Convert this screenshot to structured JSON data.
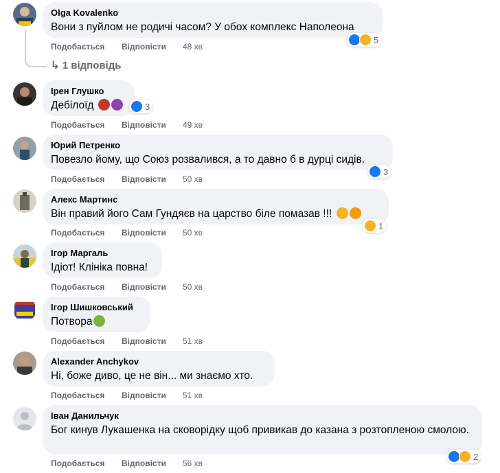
{
  "actions": {
    "like": "Подобається",
    "reply": "Відповісти"
  },
  "comments": [
    {
      "author": "Olga Kovalenko",
      "text": "Вони з пуйлом не родичі часом? У обох комплекс Наполеона",
      "time": "48 хв",
      "reactions": "5",
      "replies": "1 відповідь"
    },
    {
      "author": "Ірен Глушко",
      "text": "Дебілоїд",
      "time": "49 хв",
      "reactions": "3"
    },
    {
      "author": "Юрий Петренко",
      "text": "Повезло йому, що Союз розвалився, а то давно б в дурці сидів.",
      "time": "50 хв",
      "reactions": "3"
    },
    {
      "author": "Алекс Мартинс",
      "text": "Він правий його Сам Гундяєв на царство біле помазав !!!",
      "time": "50 хв",
      "reactions": "1"
    },
    {
      "author": "Ігор Маргаль",
      "text": "Ідіот! Клініка повна!",
      "time": "50 хв"
    },
    {
      "author": "Ігор Шишковський",
      "text": "Потвора",
      "time": "51 хв"
    },
    {
      "author": "Alexander Anchykov",
      "text": "Ні, боже диво, це не він... ми знаємо хто.",
      "time": "51 хв"
    },
    {
      "author": "Іван Данильчук",
      "text": "Бог кинув Лукашенка на сковорідку щоб привикав до казана з розтопленою смолою.",
      "time": "56 хв",
      "reactions": "2"
    }
  ],
  "colors": {
    "bubble": "#f0f2f5",
    "meta": "#65676b",
    "like": "#1877f2",
    "haha": "#f7b125"
  }
}
